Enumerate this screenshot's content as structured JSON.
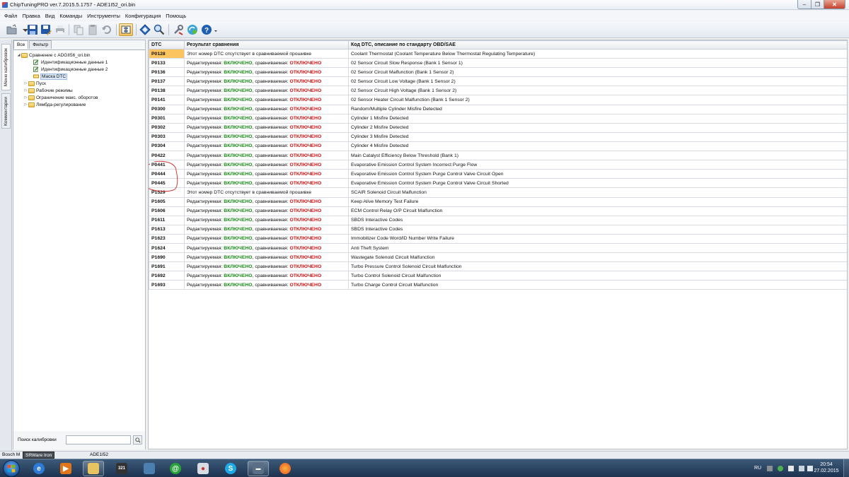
{
  "window": {
    "title": "ChipTuningPRO ver.7.2015.5.1757 - ADE1I52_ori.bin"
  },
  "menu": [
    "Файл",
    "Правка",
    "Вид",
    "Команды",
    "Инструменты",
    "Конфигурация",
    "Помощь"
  ],
  "toolbar_icons": [
    "open-icon",
    "save-icon",
    "save-as-icon",
    "print-icon",
    "copy-icon",
    "paste-icon",
    "undo-icon",
    "compare-icon",
    "navigate-icon",
    "search-icon",
    "tools-icon",
    "update-icon",
    "help-icon"
  ],
  "side_tabs": [
    "Меню калибровок",
    "Комментарии"
  ],
  "tree": {
    "tabs": [
      "Все",
      "Фильтр"
    ],
    "items": [
      {
        "label": "Сравнение с ADGII56_ori.bin"
      },
      {
        "label": "Идентификационные данные 1"
      },
      {
        "label": "Идентификационные данные 2"
      },
      {
        "label": "Маска DTC"
      },
      {
        "label": "Пуск"
      },
      {
        "label": "Рабочие режимы"
      },
      {
        "label": "Ограничение макс. оборотов"
      },
      {
        "label": "Лямбда-регулирование"
      }
    ],
    "search_label": "Поиск калибровки"
  },
  "table": {
    "headers": [
      "DTC",
      "Результат сравнения",
      "Код DTC, описание по стандарту OBD/SAE"
    ],
    "edited_label": "Редактируемая: ",
    "compared_label": ", сравниваемая: ",
    "on_label": "ВКЛЮЧЕНО",
    "off_label": "ОТКЛЮЧЕНО",
    "rows": [
      {
        "code": "P0128",
        "result": "Этот номер DTC отсутствует в сравниваемой прошивке",
        "desc": "Coolant Thermostat (Coolant Temperature Below Thermostat Regulating Temperature)",
        "highlight": true
      },
      {
        "code": "P0133",
        "result": "",
        "desc": "02 Sensor Circuit Slow Response (Bank 1 Sensor 1)"
      },
      {
        "code": "P0136",
        "result": "",
        "desc": "02 Sensor Circuit Malfunction (Bank 1 Sensor 2)"
      },
      {
        "code": "P0137",
        "result": "",
        "desc": "02 Sensor Circuit Low Voltage (Bank 1 Sensor 2)"
      },
      {
        "code": "P0138",
        "result": "",
        "desc": "02 Sensor Circuit High Voltage (Bank 1 Sensor 2)"
      },
      {
        "code": "P0141",
        "result": "",
        "desc": "02 Sensor Heater Circuit Malfunction (Bank 1 Sensor 2)"
      },
      {
        "code": "P0300",
        "result": "",
        "desc": "Random/Multiple Cylinder Misfire Detected"
      },
      {
        "code": "P0301",
        "result": "",
        "desc": "Cylinder 1 Misfire Detected"
      },
      {
        "code": "P0302",
        "result": "",
        "desc": "Cylinder 2 Misfire Detected"
      },
      {
        "code": "P0303",
        "result": "",
        "desc": "Cylinder 3 Misfire Detected"
      },
      {
        "code": "P0304",
        "result": "",
        "desc": "Cylinder 4 Misfire Detected"
      },
      {
        "code": "P0422",
        "result": "",
        "desc": "Main Catalyst Efficiency Below Threshold (Bank 1)"
      },
      {
        "code": "P0441",
        "result": "",
        "desc": "Evaporative Emission Control System Incorrect Purge Flow"
      },
      {
        "code": "P0444",
        "result": "",
        "desc": "Evaporative Emission Control System Purge Control Valve Circuit Open"
      },
      {
        "code": "P0445",
        "result": "",
        "desc": "Evaporative Emission Control System Purge Control Valve Circuit Shorted"
      },
      {
        "code": "P1529",
        "result": "Этот номер DTC отсутствует в сравниваемой прошивке",
        "desc": "SCAIR Solenoid Circuit Malfunction"
      },
      {
        "code": "P1605",
        "result": "",
        "desc": "Keep Alive Memory Test Failure"
      },
      {
        "code": "P1606",
        "result": "",
        "desc": "ECM Control Relay O/P Circuit Malfunction"
      },
      {
        "code": "P1611",
        "result": "",
        "desc": "SBDS Interactive Codes"
      },
      {
        "code": "P1613",
        "result": "",
        "desc": "SBDS Interactive Codes"
      },
      {
        "code": "P1623",
        "result": "",
        "desc": "Immobilizer Code Word/ID Number Write Failure"
      },
      {
        "code": "P1624",
        "result": "",
        "desc": "Anti Theft System"
      },
      {
        "code": "P1690",
        "result": "",
        "desc": "Wastegate Solenoid Circuit Malfunction"
      },
      {
        "code": "P1691",
        "result": "",
        "desc": "Turbo Pressure Control Solenoid Circuit Malfunction"
      },
      {
        "code": "P1692",
        "result": "",
        "desc": "Turbo Control Solenoid Circuit Malfunction"
      },
      {
        "code": "P1693",
        "result": "",
        "desc": "Turbo Charge Control Circuit Malfunction"
      }
    ]
  },
  "statusbar": {
    "left": "Bosch M",
    "tooltip": "SRWare Iron",
    "middle": "ADE1I52"
  },
  "taskbar": {
    "apps": [
      "ie-icon",
      "media-player-icon",
      "explorer-icon",
      "video-editor-icon",
      "network-icon",
      "mail-agent-icon",
      "paint-icon",
      "skype-icon",
      "chiptuning-icon",
      "firefox-icon"
    ],
    "language": "RU",
    "time": "20:54",
    "date": "27.02.2015"
  },
  "colors": {
    "on": "#178a17",
    "off": "#d01010",
    "highlight": "#fbc45e"
  }
}
